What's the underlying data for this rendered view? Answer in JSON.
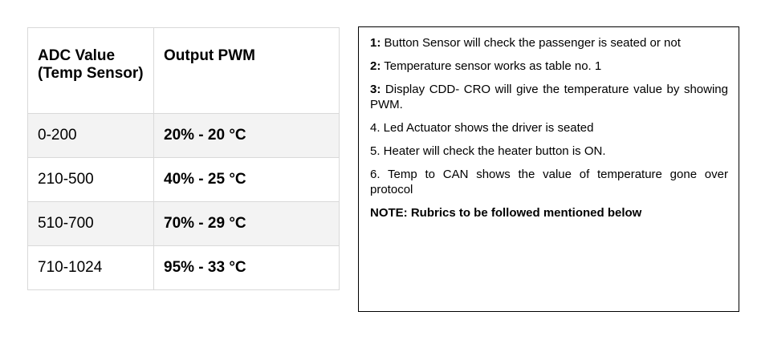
{
  "table": {
    "headers": [
      "ADC Value (Temp Sensor)",
      "Output PWM"
    ],
    "rows": [
      {
        "adc": "0-200",
        "pwm": "20% - 20 °C"
      },
      {
        "adc": "210-500",
        "pwm": "40% - 25 °C"
      },
      {
        "adc": "510-700",
        "pwm": "70% - 29 °C"
      },
      {
        "adc": "710-1024",
        "pwm": "95% - 33 °C"
      }
    ],
    "colors": {
      "border": "#d9d9d9",
      "shaded_row": "#f3f3f3"
    }
  },
  "notes": {
    "items": [
      {
        "num": "1:",
        "text": " Button Sensor will check the passenger is seated or not"
      },
      {
        "num": "2:",
        "text": " Temperature sensor works as table no. 1"
      },
      {
        "num": "3:",
        "text": " Display CDD- CRO will give the temperature value by showing PWM."
      },
      {
        "num": "4.",
        "text": " Led Actuator shows the driver is seated"
      },
      {
        "num": "5.",
        "text": " Heater will check the heater button is ON."
      },
      {
        "num": "6.",
        "text": " Temp to CAN shows the value of temperature gone over protocol"
      }
    ],
    "final_note": "NOTE: Rubrics to be followed mentioned below",
    "border_color": "#000000"
  }
}
